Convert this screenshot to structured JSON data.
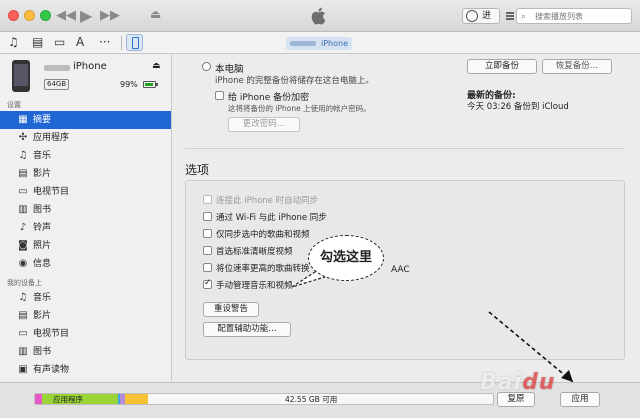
{
  "titlebar": {
    "account_label": "进",
    "search_placeholder": "搜索播放列表"
  },
  "device_tab": {
    "label": "iPhone"
  },
  "sidebar": {
    "device_name": "iPhone",
    "capacity": "64GB",
    "battery": "99%",
    "settings_label": "设置",
    "settings_items": [
      {
        "label": "摘要",
        "icon": "summary-icon",
        "active": true
      },
      {
        "label": "应用程序",
        "icon": "apps-icon"
      },
      {
        "label": "音乐",
        "icon": "music-icon"
      },
      {
        "label": "影片",
        "icon": "movie-icon"
      },
      {
        "label": "电视节目",
        "icon": "tv-icon"
      },
      {
        "label": "图书",
        "icon": "book-icon"
      },
      {
        "label": "铃声",
        "icon": "bell-icon"
      },
      {
        "label": "照片",
        "icon": "camera-icon"
      },
      {
        "label": "信息",
        "icon": "info-icon"
      }
    ],
    "ondevice_label": "我的设备上",
    "ondevice_items": [
      {
        "label": "音乐",
        "icon": "music-icon"
      },
      {
        "label": "影片",
        "icon": "movie-icon"
      },
      {
        "label": "电视节目",
        "icon": "tv-icon"
      },
      {
        "label": "图书",
        "icon": "book-icon"
      },
      {
        "label": "有声读物",
        "icon": "audiobook-icon"
      }
    ]
  },
  "backup": {
    "this_computer": "本电脑",
    "this_computer_desc": "iPhone 的完整备份将储存在这台电脑上。",
    "encrypt_label": "给 iPhone 备份加密",
    "encrypt_desc": "这将将备份的 iPhone 上使用的帐户密码。",
    "change_password": "更改密码…",
    "backup_now": "立即备份",
    "restore_backup": "恢复备份…",
    "latest_label": "最新的备份:",
    "latest_value": "今天 03:26 备份到 iCloud"
  },
  "options": {
    "title": "选项",
    "items": [
      {
        "label": "连接此 iPhone 时自动同步",
        "disabled": true,
        "checked": false
      },
      {
        "label": "通过 Wi-Fi 与此 iPhone 同步",
        "disabled": false,
        "checked": false
      },
      {
        "label": "仅同步选中的歌曲和视频",
        "disabled": false,
        "checked": false
      },
      {
        "label": "首选标准清晰度视频",
        "disabled": false,
        "checked": false
      },
      {
        "label": "将位速率更高的歌曲转换",
        "disabled": false,
        "checked": false
      },
      {
        "label": "手动管理音乐和视频",
        "disabled": false,
        "checked": true
      }
    ],
    "aac": "AAC",
    "reset_warnings": "重设警告",
    "accessibility": "配置辅助功能…"
  },
  "callout": "勾选这里",
  "storage": {
    "apps_label": "应用程序",
    "free_label": "42.55 GB 可用",
    "segments": [
      {
        "color": "#e858c8",
        "fraction": 0.016
      },
      {
        "color": "#9bd437",
        "fraction": 0.165
      },
      {
        "color": "#3ea6e8",
        "fraction": 0.005
      },
      {
        "color": "#b58cd7",
        "fraction": 0.01
      },
      {
        "color": "#f6c233",
        "fraction": 0.05
      }
    ],
    "revert_label": "复原",
    "apply_label": "应用"
  },
  "watermark": "Baidu"
}
